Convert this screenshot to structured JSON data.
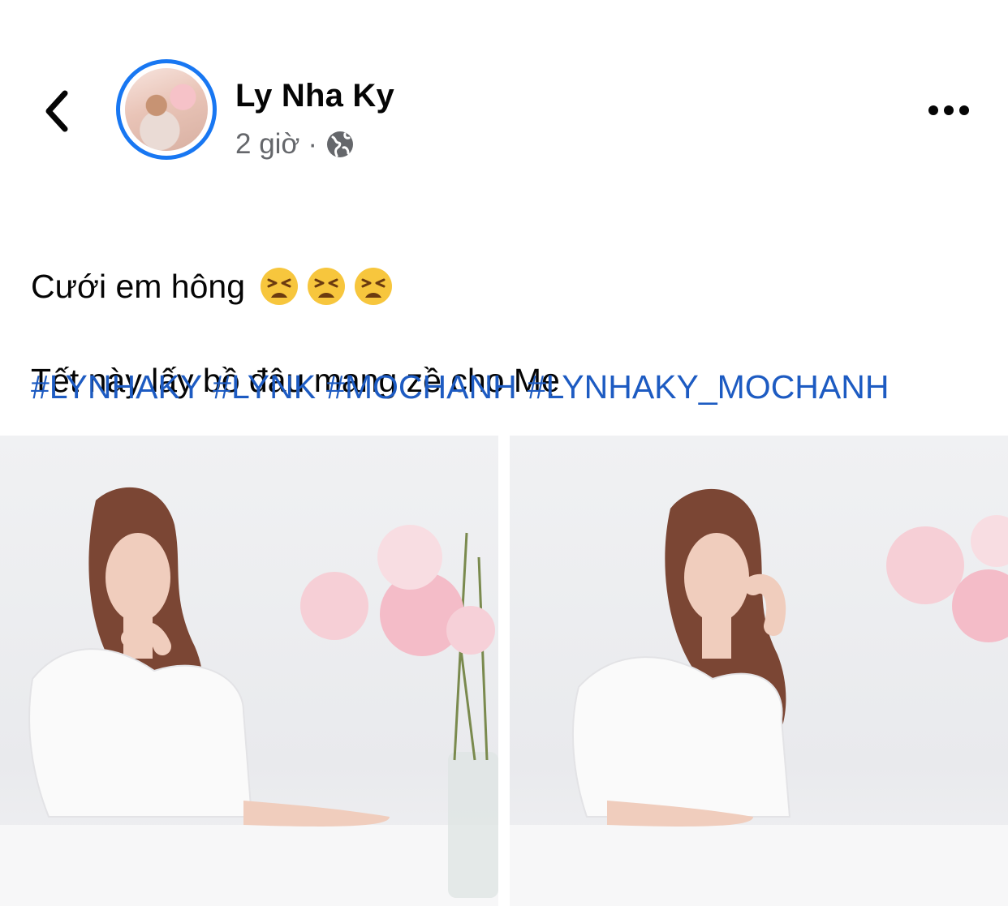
{
  "header": {
    "back_icon": "chevron-left-icon",
    "author_name": "Ly Nha Ky",
    "time_ago": "2 giờ",
    "separator": "·",
    "audience_icon": "globe-icon",
    "more_icon": "more-horizontal-icon"
  },
  "post": {
    "line1": "Cưới em hông",
    "line1_emoji": [
      "tired-face-emoji",
      "tired-face-emoji",
      "tired-face-emoji"
    ],
    "line2": "Tết này lấy bồ đâu mang zề cho Mẹ",
    "hashtags": [
      "#LYNHAKY",
      "#LYNK",
      "#MOCHANH",
      "#LYNHAKY_MOCHANH"
    ]
  },
  "photos": [
    {
      "subject": "woman-white-dress-pink-roses-left"
    },
    {
      "subject": "woman-white-dress-pink-roses-right"
    }
  ],
  "colors": {
    "accent": "#1877f2",
    "hashtag": "#1d5bc2",
    "secondary_text": "#65676b",
    "text": "#050505"
  }
}
